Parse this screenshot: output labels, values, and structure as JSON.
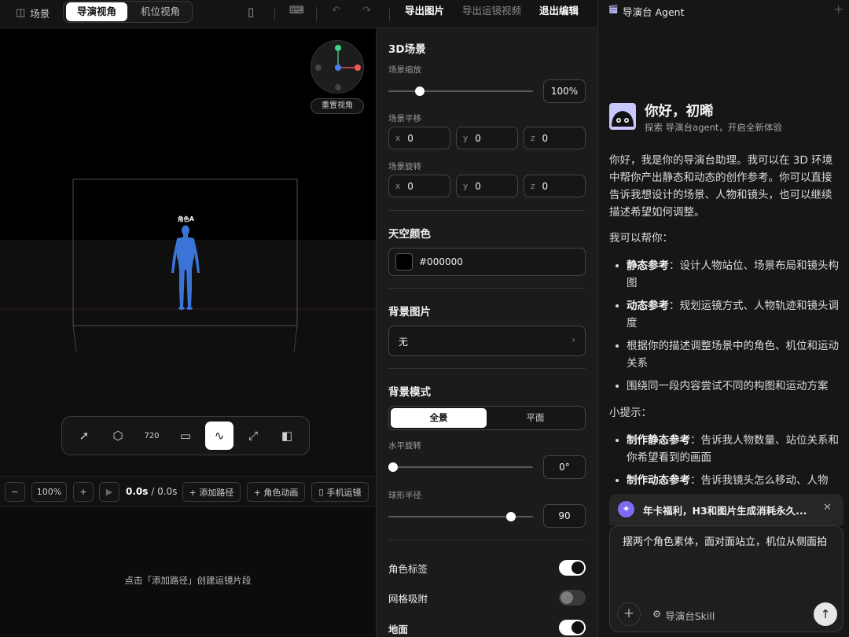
{
  "topbar": {
    "scene_label": "场景",
    "tabs": [
      "导演视角",
      "机位视角"
    ],
    "active_tab": "导演视角",
    "export_image": "导出图片",
    "export_video": "导出运镜视频",
    "exit_edit": "退出编辑"
  },
  "viewport": {
    "reset_view": "重置视角",
    "character_label": "角色A",
    "tools": [
      {
        "name": "select-icon",
        "glyph": "➚"
      },
      {
        "name": "cube-icon",
        "glyph": "⬡"
      },
      {
        "name": "rotate-720-icon",
        "glyph": "720"
      },
      {
        "name": "camera-icon",
        "glyph": "▭"
      },
      {
        "name": "path-icon",
        "glyph": "∿"
      },
      {
        "name": "frame-icon",
        "glyph": "⤢"
      },
      {
        "name": "panel-icon",
        "glyph": "◧"
      }
    ]
  },
  "timeline": {
    "minus": "−",
    "zoom": "100%",
    "plus": "+",
    "time_current": "0.0s",
    "time_total": "/ 0.0s",
    "add_path": "+ 添加路径",
    "char_anim": "+ 角色动画",
    "phone_move": "手机运镜",
    "empty_hint": "点击「添加路径」创建运镜片段"
  },
  "settings": {
    "title": "3D场景",
    "scale_label": "场景缩放",
    "scale_value": "100%",
    "scale_fraction": 0.2,
    "translate_label": "场景平移",
    "translate": [
      {
        "k": "x",
        "v": "0"
      },
      {
        "k": "y",
        "v": "0"
      },
      {
        "k": "z",
        "v": "0"
      }
    ],
    "rotate_label": "场景旋转",
    "rotate": [
      {
        "k": "x",
        "v": "0"
      },
      {
        "k": "y",
        "v": "0"
      },
      {
        "k": "z",
        "v": "0"
      }
    ],
    "sky_title": "天空颜色",
    "sky_hex": "#000000",
    "bg_image_title": "背景图片",
    "bg_image_value": "无",
    "bg_mode_title": "背景模式",
    "bg_modes": [
      "全景",
      "平面"
    ],
    "h_rotate_label": "水平旋转",
    "h_rotate_value": "0°",
    "radius_label": "球形半径",
    "radius_value": "90",
    "radius_fraction": 0.87,
    "toggles": [
      {
        "label": "角色标签",
        "on": true
      },
      {
        "label": "网格吸附",
        "on": false
      },
      {
        "label": "地面",
        "on": true
      }
    ]
  },
  "agent": {
    "title": "导演台 Agent",
    "greeting": "你好，初晞",
    "subtitle": "探索 导演台agent，开启全新体验",
    "intro": "你好，我是你的导演台助理。我可以在 3D 环境中帮你产出静态和动态的创作参考。你可以直接告诉我想设计的场景、人物和镜头，也可以继续描述希望如何调整。",
    "help_title": "我可以帮你：",
    "help_items": [
      {
        "bold": "静态参考",
        "text": "：设计人物站位、场景布局和镜头构图"
      },
      {
        "bold": "动态参考",
        "text": "：规划运镜方式、人物轨迹和镜头调度"
      },
      {
        "bold": "",
        "text": "根据你的描述调整场景中的角色、机位和运动关系"
      },
      {
        "bold": "",
        "text": "围绕同一段内容尝试不同的构图和运动方案"
      }
    ],
    "tips_title": "小提示：",
    "tips_items": [
      {
        "bold": "制作静态参考",
        "text": "：告诉我人物数量、站位关系和你希望看到的画面"
      },
      {
        "bold": "制作动态参考",
        "text": "：告诉我镜头怎么移动、人物"
      }
    ],
    "promo": "年卡福利，H3和图片生成消耗永久...",
    "input_text": "摆两个角色素体，面对面站立，机位从侧面拍",
    "skill_label": "导演台Skill"
  }
}
